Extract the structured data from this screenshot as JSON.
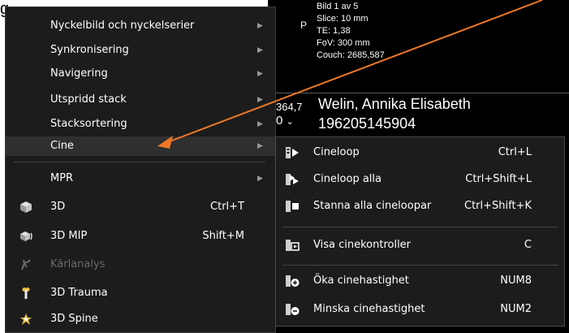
{
  "top_fragment": "g",
  "overlay": {
    "left_letter": "P",
    "image_info": [
      "Bild 1 av 5",
      "Slice: 10 mm",
      "TE: 1,38",
      "FoV: 300 mm",
      "Couch: 2685,587"
    ],
    "left_number": "364,7",
    "left_zero": "0",
    "patient_name": "Welin, Annika Elisabeth",
    "patient_id": "196205145904"
  },
  "menu": {
    "items": [
      {
        "label": "Nyckelbild och nyckelserier",
        "submenu": true
      },
      {
        "label": "Synkronisering",
        "submenu": true
      },
      {
        "label": "Navigering",
        "submenu": true
      },
      {
        "label": "Utspridd stack",
        "submenu": true
      },
      {
        "label": "Stacksortering",
        "submenu": true
      },
      {
        "label": "Cine",
        "submenu": true,
        "highlighted": true
      },
      {
        "label": "MPR",
        "submenu": true
      },
      {
        "label": "3D",
        "shortcut": "Ctrl+T",
        "icon": "cube-icon"
      },
      {
        "label": "3D MIP",
        "shortcut": "Shift+M",
        "icon": "mip-cube-icon"
      },
      {
        "label": "Kärlanalys",
        "disabled": true,
        "icon": "vessel-icon"
      },
      {
        "label": "3D Trauma",
        "icon": "bone-icon"
      },
      {
        "label": "3D Spine",
        "icon": "spine-icon"
      }
    ]
  },
  "submenu": {
    "items": [
      {
        "label": "Cineloop",
        "shortcut": "Ctrl+L",
        "icon": "cineloop-icon"
      },
      {
        "label": "Cineloop alla",
        "shortcut": "Ctrl+Shift+L",
        "icon": "cineloop-all-icon"
      },
      {
        "label": "Stanna alla cineloopar",
        "shortcut": "Ctrl+Shift+K",
        "icon": "stop-cine-icon"
      },
      {
        "label": "Visa cinekontroller",
        "shortcut": "C",
        "icon": "cine-controls-icon"
      },
      {
        "label": "Öka cinehastighet",
        "shortcut": "NUM8",
        "icon": "increase-speed-icon"
      },
      {
        "label": "Minska cinehastighet",
        "shortcut": "NUM2",
        "icon": "decrease-speed-icon"
      }
    ]
  },
  "colors": {
    "annotation_arrow": "#f07828",
    "menu_bg": "#1c1c1c",
    "highlight": "#2f2f2f"
  }
}
